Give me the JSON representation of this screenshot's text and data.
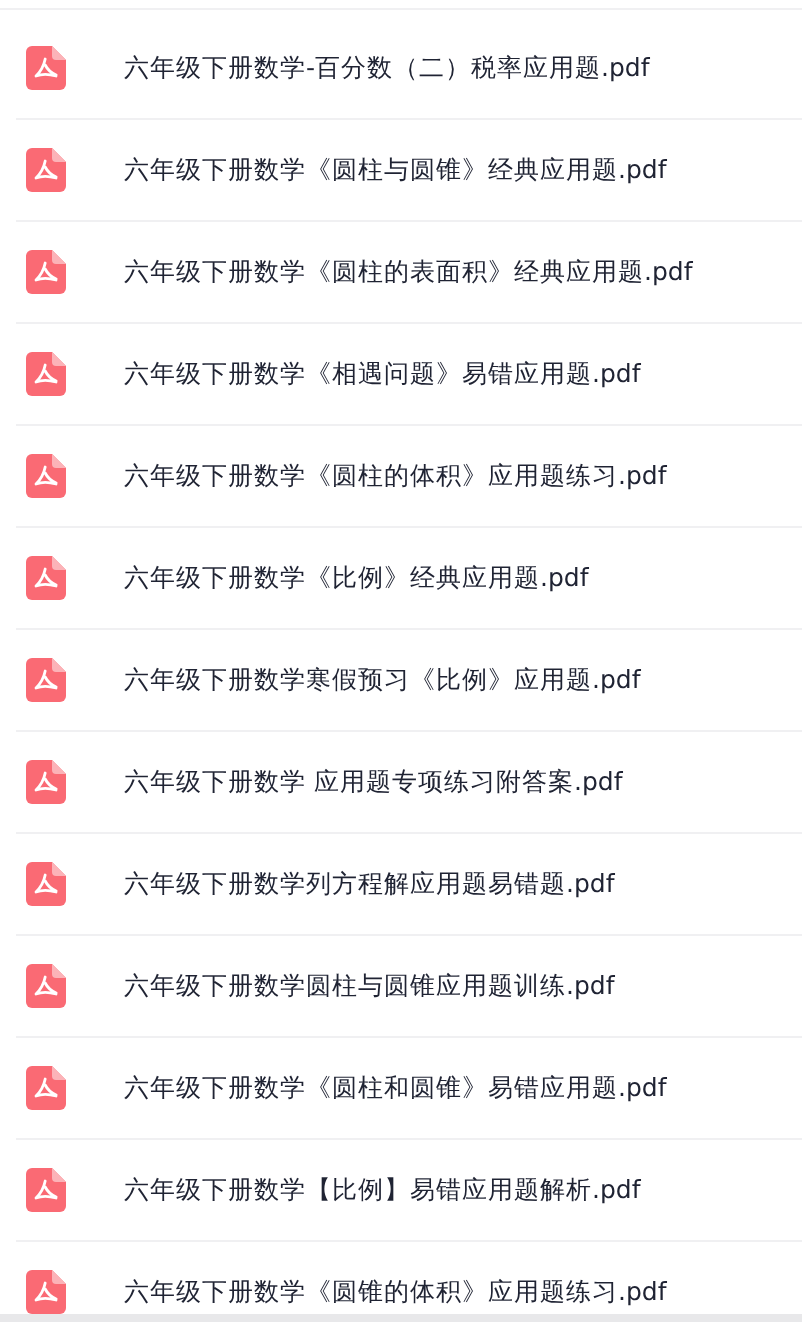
{
  "files": [
    {
      "name": "六年级下册数学-百分数（二）税率应用题.pdf"
    },
    {
      "name": "六年级下册数学《圆柱与圆锥》经典应用题.pdf"
    },
    {
      "name": "六年级下册数学《圆柱的表面积》经典应用题.pdf"
    },
    {
      "name": "六年级下册数学《相遇问题》易错应用题.pdf"
    },
    {
      "name": "六年级下册数学《圆柱的体积》应用题练习.pdf"
    },
    {
      "name": "六年级下册数学《比例》经典应用题.pdf"
    },
    {
      "name": "六年级下册数学寒假预习《比例》应用题.pdf"
    },
    {
      "name": "六年级下册数学 应用题专项练习附答案.pdf"
    },
    {
      "name": "六年级下册数学列方程解应用题易错题.pdf"
    },
    {
      "name": "六年级下册数学圆柱与圆锥应用题训练.pdf"
    },
    {
      "name": "六年级下册数学《圆柱和圆锥》易错应用题.pdf"
    },
    {
      "name": "六年级下册数学【比例】易错应用题解析.pdf"
    },
    {
      "name": "六年级下册数学《圆锥的体积》应用题练习.pdf"
    }
  ]
}
